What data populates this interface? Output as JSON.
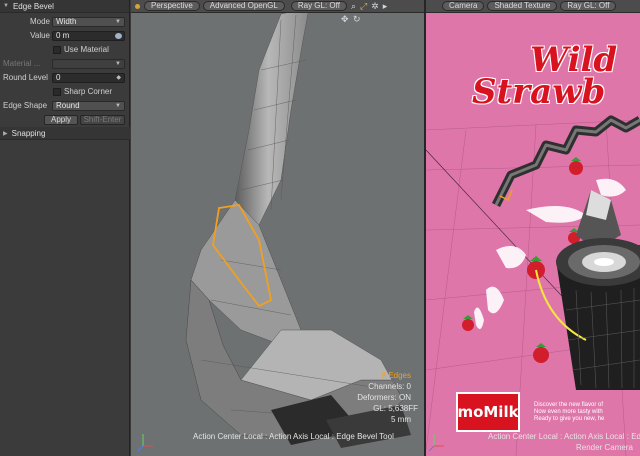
{
  "tool_panel": {
    "section_title": "Edge Bevel",
    "mode": {
      "label": "Mode",
      "value": "Width"
    },
    "value": {
      "label": "Value",
      "value": "0 m"
    },
    "use_material": {
      "label": "Use Material"
    },
    "material": {
      "label": "Material  ...",
      "value": ""
    },
    "round_level": {
      "label": "Round Level",
      "value": "0"
    },
    "sharp_corner": {
      "label": "Sharp Corner"
    },
    "edge_shape": {
      "label": "Edge Shape",
      "value": "Round"
    },
    "apply_label": "Apply",
    "shortcut_label": "Shift-Enter",
    "snapping_title": "Snapping"
  },
  "viewport_left": {
    "view_label": "Perspective",
    "render_label": "Advanced OpenGL",
    "raygl_label": "Ray GL: Off",
    "selection_info": "8 Edges",
    "channels": "Channels: 0",
    "deformers": "Deformers: ON",
    "gl_info": "GL: 5,638FF",
    "grid_size": "5 mm",
    "status": "Action Center Local : Action Axis Local : Edge Bevel Tool"
  },
  "viewport_right": {
    "view_label": "Camera",
    "render_label": "Shaded Texture",
    "raygl_label": "Ray GL: Off",
    "status": "Action Center Local : Action Axis Local : Ed",
    "camera_label": "Render Camera",
    "ad": {
      "title_line1": "Wild",
      "title_line2": "Strawb",
      "brand": "moMilk",
      "copy_line1": "Discover the new flavor of",
      "copy_line2": "Now even more tasty with",
      "copy_line3": "Ready to give you new, he"
    }
  },
  "colors": {
    "accent_orange": "#f0a020",
    "brand_red": "#d8131f",
    "background_pink": "#df76aa"
  }
}
